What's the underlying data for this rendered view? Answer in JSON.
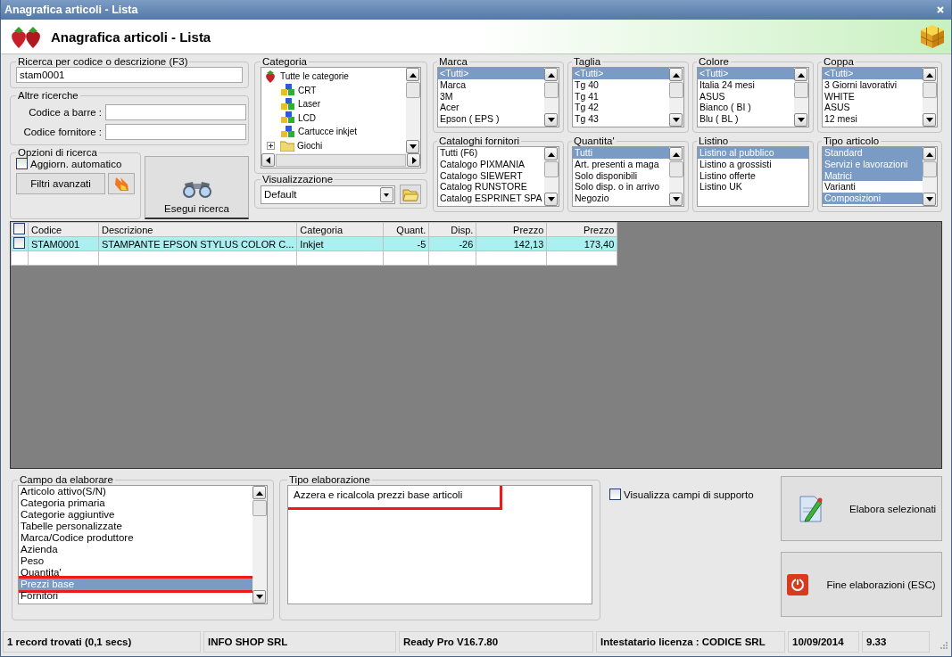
{
  "window": {
    "title": "Anagrafica articoli  - Lista"
  },
  "header": {
    "title": "Anagrafica articoli  - Lista"
  },
  "search": {
    "label": "Ricerca per codice o descrizione (F3)",
    "value": "stam0001"
  },
  "other_searches": {
    "label": "Altre ricerche",
    "fields": [
      {
        "label": "Codice a barre :"
      },
      {
        "label": "Codice fornitore :"
      }
    ]
  },
  "search_options": {
    "label": "Opzioni di ricerca",
    "auto_update": {
      "label": "Aggiorn. automatico",
      "checked": false
    },
    "advanced_button": "Filtri avanzati"
  },
  "run_button": "Esegui ricerca",
  "category": {
    "label": "Categoria",
    "tree": [
      {
        "label": "Tutte le categorie",
        "kind": "root",
        "children": [
          {
            "label": "CRT",
            "kind": "group"
          },
          {
            "label": "Laser",
            "kind": "group"
          },
          {
            "label": "LCD",
            "kind": "group"
          },
          {
            "label": "Cartucce inkjet",
            "kind": "group"
          },
          {
            "label": "Giochi",
            "kind": "folder",
            "expanded": false
          }
        ]
      }
    ]
  },
  "view": {
    "label": "Visualizzazione",
    "value": "Default"
  },
  "filters": [
    {
      "label": "Marca",
      "scrollbar": true,
      "items": [
        {
          "label": "<Tutti>",
          "selected": true
        },
        {
          "label": "Marca",
          "selected": false
        },
        {
          "label": "3M",
          "selected": false
        },
        {
          "label": "Acer",
          "selected": false
        },
        {
          "label": "Epson ( EPS )",
          "selected": false
        }
      ]
    },
    {
      "label": "Taglia",
      "scrollbar": true,
      "items": [
        {
          "label": "<Tutti>",
          "selected": true
        },
        {
          "label": "Tg 40",
          "selected": false
        },
        {
          "label": "Tg 41",
          "selected": false
        },
        {
          "label": "Tg 42",
          "selected": false
        },
        {
          "label": "Tg 43",
          "selected": false
        }
      ]
    },
    {
      "label": "Colore",
      "scrollbar": true,
      "items": [
        {
          "label": "<Tutti>",
          "selected": true
        },
        {
          "label": "Italia 24 mesi",
          "selected": false
        },
        {
          "label": "ASUS",
          "selected": false
        },
        {
          "label": "Bianco ( BI )",
          "selected": false
        },
        {
          "label": "Blu ( BL )",
          "selected": false
        }
      ]
    },
    {
      "label": "Coppa",
      "scrollbar": true,
      "items": [
        {
          "label": "<Tutti>",
          "selected": true
        },
        {
          "label": "3 Giorni lavorativi",
          "selected": false
        },
        {
          "label": "WHITE",
          "selected": false
        },
        {
          "label": "ASUS",
          "selected": false
        },
        {
          "label": "12 mesi",
          "selected": false
        }
      ]
    },
    {
      "label": "Cataloghi fornitori",
      "scrollbar": true,
      "items": [
        {
          "label": "Tutti (F6)",
          "selected": false
        },
        {
          "label": "Catalogo PIXMANIA",
          "selected": false
        },
        {
          "label": "Catalogo SIEWERT",
          "selected": false
        },
        {
          "label": "Catalog RUNSTORE",
          "selected": false
        },
        {
          "label": "Catalog ESPRINET SPA",
          "selected": false
        }
      ]
    },
    {
      "label": "Quantita'",
      "scrollbar": true,
      "items": [
        {
          "label": "Tutti",
          "selected": true
        },
        {
          "label": "Art. presenti a maga",
          "selected": false
        },
        {
          "label": "Solo disponibili",
          "selected": false
        },
        {
          "label": "Solo disp. o in arrivo",
          "selected": false
        },
        {
          "label": "Negozio",
          "selected": false
        }
      ]
    },
    {
      "label": "Listino",
      "scrollbar": false,
      "items": [
        {
          "label": "Listino al pubblico",
          "selected": true
        },
        {
          "label": "Listino a grossisti",
          "selected": false
        },
        {
          "label": "Listino offerte",
          "selected": false
        },
        {
          "label": "Listino UK",
          "selected": false
        }
      ]
    },
    {
      "label": "Tipo articolo",
      "scrollbar": true,
      "items": [
        {
          "label": "Standard",
          "selected": true
        },
        {
          "label": "Servizi e lavorazioni",
          "selected": true
        },
        {
          "label": "Matrici",
          "selected": true
        },
        {
          "label": "Varianti",
          "selected": false
        },
        {
          "label": "Composizioni",
          "selected": true
        }
      ]
    }
  ],
  "table": {
    "all_checked": false,
    "columns": [
      {
        "label": "Codice",
        "kind": "text"
      },
      {
        "label": "Descrizione",
        "kind": "text"
      },
      {
        "label": "Categoria",
        "kind": "text"
      },
      {
        "label": "Quant.",
        "kind": "number"
      },
      {
        "label": "Disp.",
        "kind": "number"
      },
      {
        "label": "Prezzo",
        "kind": "number"
      },
      {
        "label": "Prezzo",
        "kind": "number"
      }
    ],
    "rows": [
      {
        "selected": true,
        "checked": false,
        "cells": [
          "STAM0001",
          "STAMPANTE EPSON STYLUS COLOR C...",
          "Inkjet",
          "-5",
          "-26",
          "142,13",
          "173,40"
        ]
      }
    ]
  },
  "process": {
    "field_group": {
      "label": "Campo da elaborare",
      "items": [
        {
          "label": "Articolo attivo(S/N)",
          "selected": false,
          "highlighted": false
        },
        {
          "label": "Categoria primaria",
          "selected": false,
          "highlighted": false
        },
        {
          "label": "Categorie aggiuntive",
          "selected": false,
          "highlighted": false
        },
        {
          "label": "Tabelle personalizzate",
          "selected": false,
          "highlighted": false
        },
        {
          "label": "Marca/Codice produttore",
          "selected": false,
          "highlighted": false
        },
        {
          "label": "Azienda",
          "selected": false,
          "highlighted": false
        },
        {
          "label": "Peso",
          "selected": false,
          "highlighted": false
        },
        {
          "label": "Quantita'",
          "selected": false,
          "highlighted": false
        },
        {
          "label": "Prezzi base",
          "selected": true,
          "highlighted": true
        },
        {
          "label": "Fornitori",
          "selected": false,
          "highlighted": false
        }
      ]
    },
    "type_group": {
      "label": "Tipo elaborazione",
      "items": [
        {
          "label": "Azzera e ricalcola prezzi base articoli",
          "highlighted": true
        }
      ]
    },
    "support_fields": {
      "label": "Visualizza campi di supporto",
      "checked": false
    },
    "buttons": [
      {
        "label": "Elabora selezionati",
        "kind": "process"
      },
      {
        "label": "Fine elaborazioni (ESC)",
        "kind": "exit"
      }
    ]
  },
  "status_bar": [
    "1 record trovati (0,1 secs)",
    "INFO SHOP SRL",
    "Ready Pro V16.7.80",
    "Intestatario licenza : CODICE SRL",
    "10/09/2014",
    "9.33"
  ]
}
